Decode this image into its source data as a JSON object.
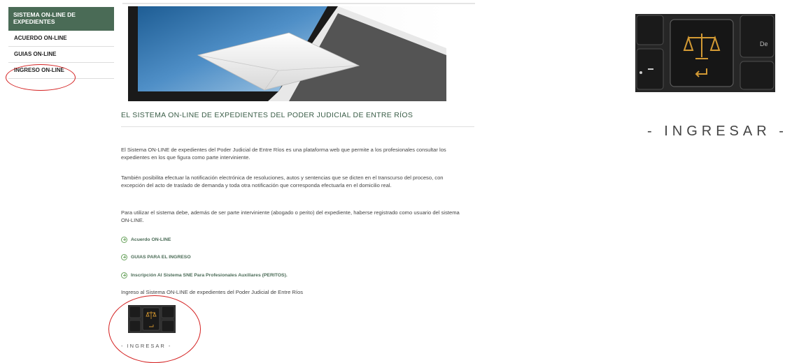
{
  "sidebar": {
    "header": "SISTEMA ON-LINE DE EXPEDIENTES",
    "items": [
      {
        "label": "ACUERDO ON-LINE"
      },
      {
        "label": "GUIAS ON-LINE"
      },
      {
        "label": "INGRESO ON-LINE"
      }
    ]
  },
  "main": {
    "title": "EL SISTEMA ON-LINE DE EXPEDIENTES DEL PODER JUDICIAL DE ENTRE RÍOS",
    "paragraphs": [
      "El Sistema ON-LINE de expedientes del Poder Judicial de Entre Ríos es una plataforma web que permite a los profesionales consultar los expedientes en los que figura como parte interviniente.",
      "También posibilita efectuar la notificación electrónica de resoluciones, autos y sentencias que se dicten en el transcurso del proceso, con excepción del acto de traslado de demanda y toda otra notificación que corresponda efectuarla en el domicilio real.",
      "Para utilizar el sistema debe, además de ser parte interviniente (abogado o perito) del expediente, haberse registrado como usuario del sistema ON-LINE."
    ],
    "links": [
      {
        "label": "Acuerdo ON-LINE"
      },
      {
        "label": "GUIAS PARA EL INGRESO"
      },
      {
        "label": "Inscripción Al Sistema SNE Para Profesionales Auxiliares (PERITOS)."
      }
    ],
    "ingreso_text": "Ingreso al  Sistema ON-LINE de expedientes del Poder Judicial de Entre Ríos",
    "ingresar_small": "- INGRESAR -"
  },
  "right_panel": {
    "ingresar_big": "- INGRESAR -"
  },
  "colors": {
    "sidebar_header_bg": "#4a6b56",
    "link_green": "#6aa35e",
    "annotation_red": "#d42020"
  }
}
